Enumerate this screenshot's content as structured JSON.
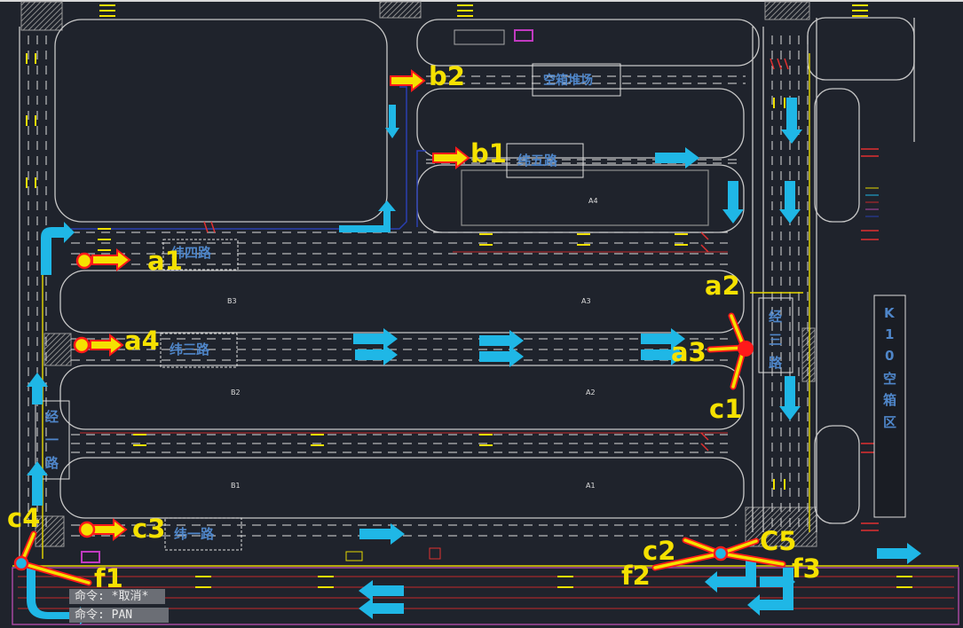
{
  "labels": {
    "a1": "a1",
    "a2": "a2",
    "a3": "a3",
    "a4": "a4",
    "b1": "b1",
    "b2": "b2",
    "c1": "c1",
    "c2": "c2",
    "c3": "c3",
    "c4": "c4",
    "c5": "C5",
    "f1": "f1",
    "f2": "f2",
    "f3": "f3"
  },
  "roads": {
    "wei1": "纬一路",
    "wei3": "纬三路",
    "wei4": "纬四路",
    "wei5": "纬五路",
    "jing1": [
      "经",
      "一",
      "路"
    ],
    "jing3": [
      "经",
      "三",
      "路"
    ]
  },
  "areas": {
    "empty_yard": "空箱堆场",
    "k10": [
      "K",
      "1",
      "0",
      "空",
      "箱",
      "区"
    ]
  },
  "blocks": [
    "A4",
    "A3",
    "A2",
    "A1",
    "B3",
    "B2",
    "B1"
  ],
  "command_lines": [
    "命令:  *取消*",
    "命令:  PAN"
  ],
  "colors": {
    "background": "#1f232c",
    "road_edge": "#c8c8c8",
    "lane_dash": "#dcdcdc",
    "arrow_blue": "#1fb7e6",
    "marker_yellow": "#f5e100",
    "marker_red": "#ff1a1a",
    "road_label": "#4f86c9",
    "boundary_magenta": "#b04aa8"
  }
}
